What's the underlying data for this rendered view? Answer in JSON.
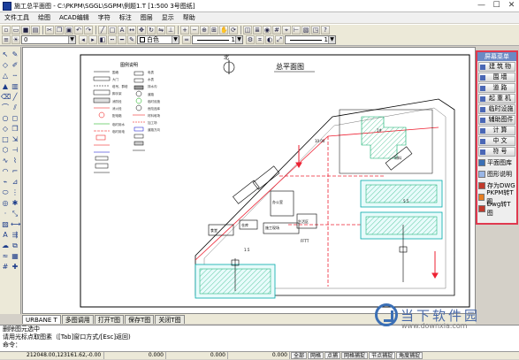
{
  "window": {
    "title": "施工总平面图 - C:\\PKPM\\SGGL\\SGPM\\例题1.T  [1:500  3号图纸]",
    "minimize": "—",
    "maximize": "☐",
    "close": "✕"
  },
  "menu": {
    "items": [
      "文件工具",
      "绘图",
      "ACAD编辑",
      "字符",
      "标注",
      "图层",
      "显示",
      "帮助"
    ]
  },
  "toolbar2": {
    "layer_value": "0",
    "color_value": "白色",
    "linetype_1": "1",
    "linetype_2": "1"
  },
  "drawing": {
    "north_label": "北",
    "title": "总平面图",
    "legend_title": "图例说明",
    "legend_items": [
      "围墙",
      "大门",
      "塔吊、群塔",
      "脚手架",
      "消防栓",
      "消火栓",
      "配电箱",
      "临时用水",
      "临时用电",
      "电表",
      "水表",
      "排水沟",
      "道路",
      "临时设施",
      "危险品库",
      "材料堆场",
      "加工场",
      "道路方向"
    ],
    "labels": {
      "bldg1": "1#",
      "office": "办公室",
      "canteen": "食堂",
      "store": "仓库",
      "gate": "FFTT",
      "tag1": "施工现场",
      "tag2": "生活区",
      "tag3": "材料",
      "road1": "10.00",
      "road2": "5.5",
      "dim1": "1.5"
    }
  },
  "right_panel": {
    "header": "屏幕菜单",
    "items": [
      "建筑物",
      "围墙",
      "道路",
      "起重机",
      "临时设施",
      "辅助图件",
      "计算",
      "中文",
      "符号"
    ],
    "tools": [
      {
        "label": "平面图库",
        "color": "#3a6fb5"
      },
      {
        "label": "图形说明",
        "color": "#9ab6e6"
      },
      {
        "label": "存为DWG",
        "color": "#c0392b"
      },
      {
        "label": "PKPM转T图",
        "color": "#e67e22"
      },
      {
        "label": "Dwg转T图",
        "color": "#c0392b"
      }
    ]
  },
  "tabs": [
    "URBANE T",
    "多图调用",
    "打开T图",
    "保存T图",
    "关闭T图"
  ],
  "command": {
    "line1": "删除图元选中",
    "line2": "请用光标点取图素（[Tab]窗口方式/[Esc]返回)",
    "prompt": "命令："
  },
  "status": {
    "coords": "212048.00,123161.62,-0.00",
    "v1": "0.000",
    "v2": "0.000",
    "v3": "0.000",
    "toggles": [
      "全部",
      "网格",
      "点捕",
      "网格捕捉",
      "节点捕捉",
      "角度捕捉"
    ]
  },
  "watermark": {
    "text": "当下软件园",
    "url": "www.downxia.com"
  }
}
